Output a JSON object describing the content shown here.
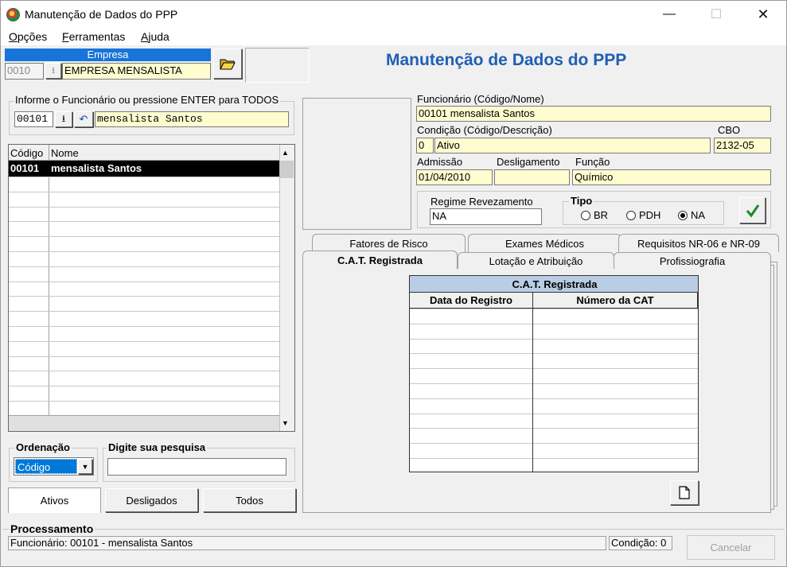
{
  "window": {
    "title": "Manutenção de Dados do PPP"
  },
  "menu": {
    "items": [
      {
        "text": "Opções",
        "u": "O",
        "rest": "pções"
      },
      {
        "text": "Ferramentas",
        "u": "F",
        "rest": "erramentas"
      },
      {
        "text": "Ajuda",
        "u": "A",
        "rest": "juda"
      }
    ]
  },
  "company": {
    "header": "Empresa",
    "code": "0010",
    "name": "EMPRESA MENSALISTA"
  },
  "page_heading": "Manutenção de Dados do PPP",
  "employee_search": {
    "label": "Informe o Funcionário ou pressione ENTER para TODOS",
    "code": "00101",
    "name": "mensalista Santos"
  },
  "list": {
    "headers": [
      "Código",
      "Nome"
    ],
    "rows": [
      {
        "code": "00101",
        "name": "mensalista Santos"
      }
    ]
  },
  "ordering": {
    "label": "Ordenação",
    "selected": "Código"
  },
  "search": {
    "label": "Digite sua pesquisa",
    "value": ""
  },
  "filter_buttons": {
    "active": "Ativos",
    "dismissed": "Desligados",
    "all": "Todos"
  },
  "employee": {
    "label": "Funcionário (Código/Nome)",
    "code": "00101",
    "name": "mensalista Santos",
    "condition_label": "Condição (Código/Descrição)",
    "condition_code": "0",
    "condition_desc": "Ativo",
    "cbo_label": "CBO",
    "cbo": "2132-05",
    "admission_label": "Admissão",
    "admission": "01/04/2010",
    "dismissal_label": "Desligamento",
    "dismissal": "",
    "function_label": "Função",
    "function": "Químico"
  },
  "regime": {
    "label": "Regime Revezamento",
    "value": "NA"
  },
  "tipo": {
    "label": "Tipo",
    "options": [
      "BR",
      "PDH",
      "NA"
    ],
    "selected": "NA"
  },
  "tabs": {
    "row1": [
      "Fatores de Risco",
      "Exames Médicos",
      "Requisitos NR-06 e NR-09"
    ],
    "row2": [
      "C.A.T. Registrada",
      "Lotação e Atribuição",
      "Profissiografia"
    ],
    "active": "C.A.T. Registrada"
  },
  "cat_table": {
    "title": "C.A.T. Registrada",
    "headers": [
      "Data do Registro",
      "Número da CAT"
    ]
  },
  "processing": {
    "label": "Processamento",
    "status": "Funcionário: 00101 - mensalista Santos",
    "condition": "Condição: 0",
    "cancel": "Cancelar"
  }
}
